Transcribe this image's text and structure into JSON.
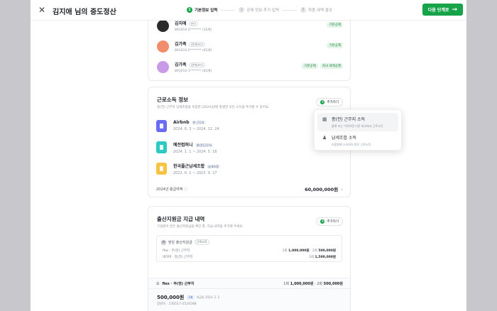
{
  "header": {
    "close_icon": "close-icon",
    "title": "김지애 님의 중도정산",
    "steps": [
      {
        "num": "1",
        "label": "기본정보 입력",
        "active": true
      },
      {
        "num": "2",
        "label": "공제 정보 추가 입력",
        "active": false
      },
      {
        "num": "3",
        "label": "최종 세액 결과",
        "active": false
      }
    ],
    "next_label": "다음 단계로",
    "next_icon": "arrow-right-icon"
  },
  "family": [
    {
      "name": "김지애",
      "tag": "본인",
      "id": "891010-2******* (35세)",
      "chips": [
        "기본공제"
      ],
      "avatar_color": "#2b2b2b"
    },
    {
      "name": "김가족",
      "tag": "(관계코드)",
      "id": "891010-2******* (65세)",
      "chips": [
        "기본공제"
      ],
      "avatar_color": "#f28d6b"
    },
    {
      "name": "김가족",
      "tag": "(관계코드)",
      "id": "891010-1******* (65세)",
      "chips": [
        "기본공제",
        "자녀 세액공제"
      ],
      "avatar_color": "#c79be8"
    }
  ],
  "income": {
    "title": "근로소득 정보",
    "desc": "종(전) 근무지 납세조합을 포함한 (2024)년에 발생한 모든 소득을 추가할 수 있어요.",
    "add_label": "추가하기",
    "jobs": [
      {
        "name": "Airbnb",
        "tag": "현 근무지",
        "date": "2024. 6. 3 ~ 2024. 12. 24",
        "color": "#6b6cf6"
      },
      {
        "name": "예전컴퍼니",
        "tag": "종(전)근무지",
        "date": "2024. 1. 1 ~ 2024. 5. 18",
        "color": "#2fc9c4"
      },
      {
        "name": "한국플근납세조합",
        "tag": "납세조합",
        "date": "2022. 6. 1 ~ 2022. 9. 27",
        "color": "#f6c343"
      }
    ],
    "total_label": "2024년 총급여액",
    "total_value": "60,000,000원"
  },
  "dropdown": {
    "items": [
      {
        "label": "종(전) 근무지 소득",
        "sub": "올해 또는 이직하면 다른 회사에서 근로소득",
        "icon": "building-icon"
      },
      {
        "label": "납세조합 소득",
        "sub": "조합원에 소속되어 받은 근로소득",
        "icon": "group-icon"
      }
    ]
  },
  "birth": {
    "title": "출산지원금 지급 내역",
    "desc": "구성원이 받은 출산지원금을 확인 후, 지급 내역을 추가해 주세요.",
    "add_label": "추가하기",
    "box_title": "받은 출산지원금",
    "box_tag": "근로소득",
    "rows": [
      {
        "label": "flex · 주(현) 근무지",
        "c1": "1회",
        "a1": "1,000,000원",
        "c2": "2회",
        "a2": "500,000원"
      },
      {
        "label": "네이버 · 종(전) 근무지",
        "c1": "1회",
        "a1": "1,500,000원",
        "c2": "",
        "a2": ""
      }
    ],
    "sub_label": "flex · 주(현) 근무지",
    "sub_c1": "1회",
    "sub_a1": "1,000,000원",
    "sub_c2": "2회",
    "sub_a2": "500,000원",
    "sub_amount": "500,000원",
    "sub_count": "1회",
    "sub_date": "지급일 2024. 2. 5",
    "sub_acct": "장원호 · 230517-2524588"
  }
}
